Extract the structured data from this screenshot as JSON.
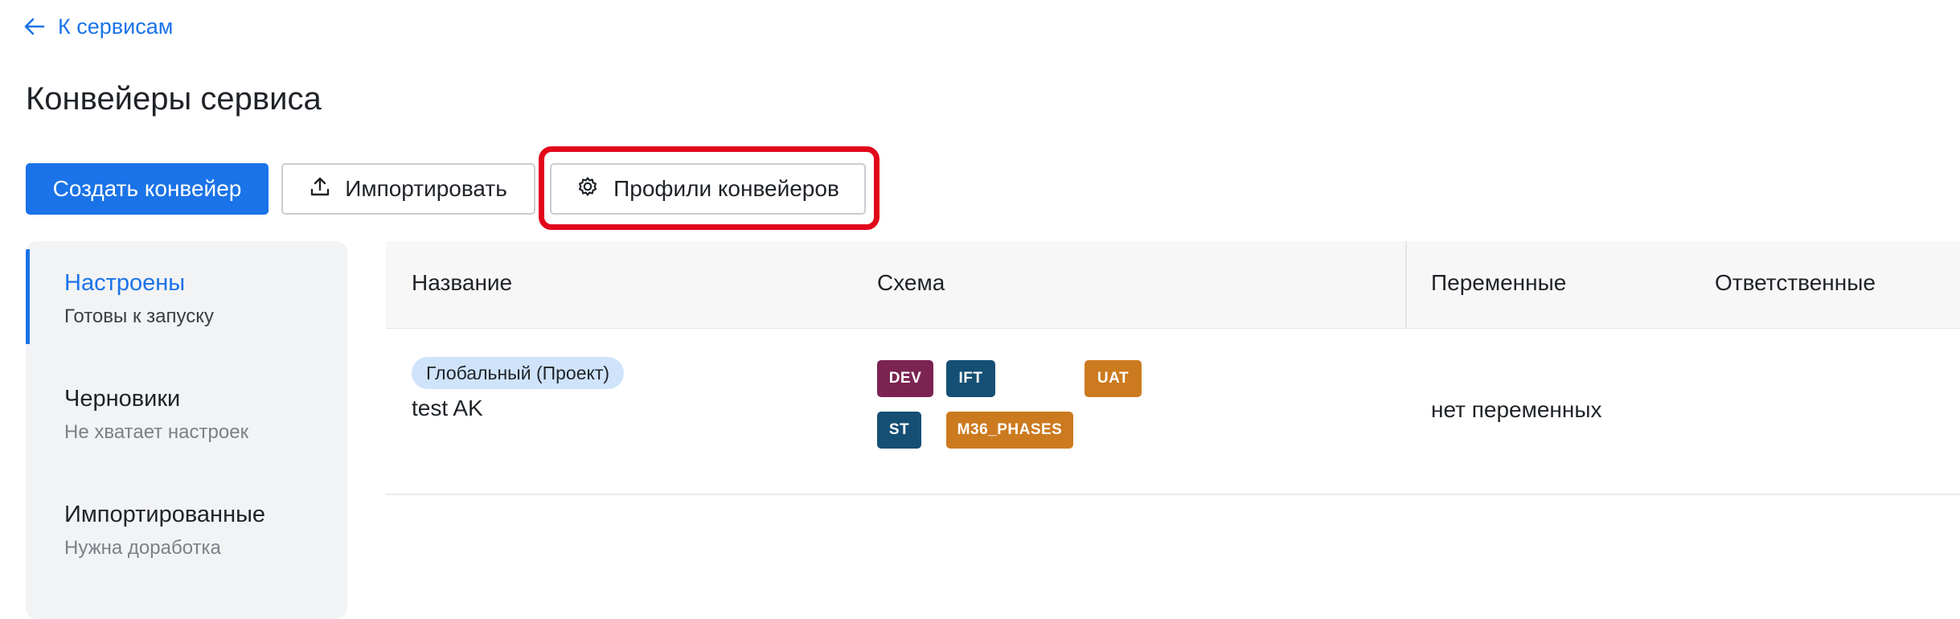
{
  "nav": {
    "back_label": "К сервисам"
  },
  "page": {
    "title": "Конвейеры сервиса"
  },
  "toolbar": {
    "create_label": "Создать конвейер",
    "import_label": "Импортировать",
    "profiles_label": "Профили конвейеров"
  },
  "sidebar": {
    "items": [
      {
        "label": "Настроены",
        "sub": "Готовы к запуску",
        "active": true
      },
      {
        "label": "Черновики",
        "sub": "Не хватает настроек",
        "active": false
      },
      {
        "label": "Импортированные",
        "sub": "Нужна доработка",
        "active": false
      }
    ]
  },
  "table": {
    "headers": [
      "Название",
      "Схема",
      "Переменные",
      "Ответственные"
    ],
    "rows": [
      {
        "scope": "Глобальный (Проект)",
        "name": "test AK",
        "stages": [
          {
            "label": "DEV",
            "color": "#7b2452"
          },
          {
            "label": "IFT",
            "color": "#154f74"
          },
          {
            "label": "UAT",
            "color": "#cc7a1f"
          },
          {
            "label": "ST",
            "color": "#154f74"
          },
          {
            "label": "M36_PHASES",
            "color": "#cc7a1f"
          }
        ],
        "variables": "нет переменных",
        "responsible": ""
      }
    ]
  },
  "colors": {
    "accent": "#1a73e8",
    "highlight": "#e1061b"
  },
  "icons": {
    "back": "arrow-left-icon",
    "import": "upload-icon",
    "profiles": "gear-icon"
  }
}
